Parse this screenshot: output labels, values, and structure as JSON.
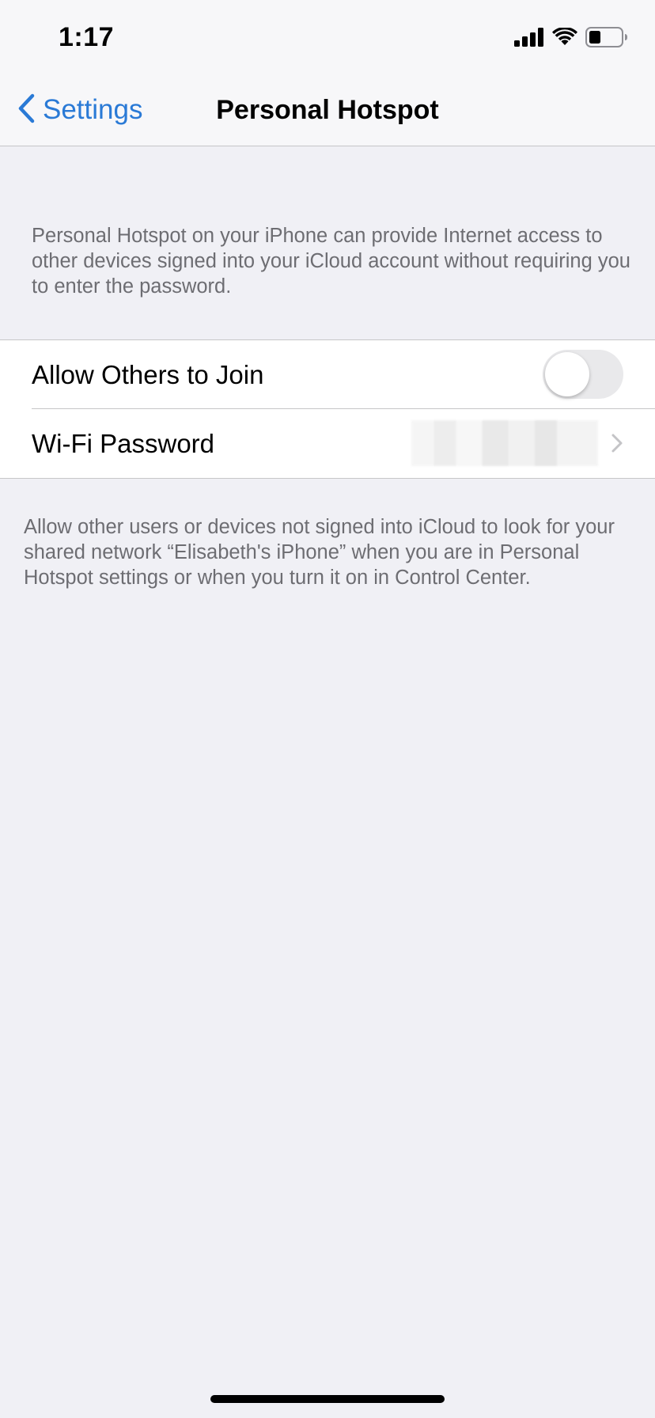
{
  "status_bar": {
    "time": "1:17",
    "icons": [
      "signal-icon",
      "wifi-icon",
      "battery-icon"
    ]
  },
  "nav": {
    "back_label": "Settings",
    "title": "Personal Hotspot"
  },
  "header_note": "Personal Hotspot on your iPhone can provide Internet access to other devices signed into your iCloud account without requiring you to enter the password.",
  "rows": [
    {
      "label": "Allow Others to Join",
      "control": "toggle",
      "on": false
    },
    {
      "label": "Wi-Fi Password",
      "control": "disclosure"
    }
  ],
  "footer_note": "Allow other users or devices not signed into iCloud to look for your shared network “Elisabeth's iPhone” when you are in Personal Hotspot settings or when you turn it on in Control Center.",
  "colors": {
    "accent": "#2a7ad6",
    "background": "#f0f0f5",
    "toggle_off": "#e9e9eb",
    "secondary_text": "#6d6d72"
  }
}
